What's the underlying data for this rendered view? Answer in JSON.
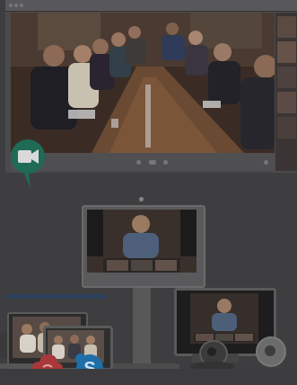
{
  "window": {
    "title": ""
  },
  "colors": {
    "background": "#3e3e40",
    "meet_green": "#1f6b55",
    "skype_blue": "#1e6fa8",
    "cloud_red": "#a8383a"
  },
  "icons": {
    "meet": "google-meet-camera-icon",
    "cloud": "cloud-icon",
    "skype": "skype-icon"
  }
}
